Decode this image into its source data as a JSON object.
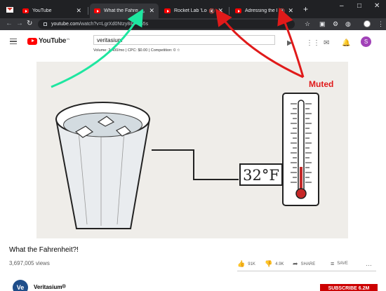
{
  "browser": {
    "tabs": [
      {
        "title": "YouTube",
        "audio": ""
      },
      {
        "title": "What the Fahrenheit",
        "audio": "🔈"
      },
      {
        "title": "Rocket Lab 'Looks",
        "audio": "🔇"
      },
      {
        "title": "Adressing the Ru",
        "audio": "🔇"
      }
    ],
    "new_tab": "+",
    "win_min": "–",
    "win_max": "□",
    "win_close": "✕",
    "url_host": "youtube.com",
    "url_path": "/watch?v=LgrXd0Ntzy8&t=165s"
  },
  "youtube": {
    "logo_word": "YouTube",
    "logo_country": "IN",
    "search_value": "veritasium",
    "seo_line": "Volume: 2,400/mo | CPC: $0.00 | Competition: 0 ☆",
    "avatar_letter": "S"
  },
  "video": {
    "label_temp": "32°F",
    "title": "What the Fahrenheit?!",
    "views": "3,697,005 views",
    "likes": "91K",
    "dislikes": "4.9K",
    "share": "SHARE",
    "save": "SAVE",
    "more": "…"
  },
  "channel": {
    "name": "Veritasium",
    "avatar_text": "Ve",
    "subscribe": "SUBSCRIBE 6.2M"
  },
  "annotation": {
    "muted_label": "Muted",
    "arrow_green": "#1ee6a0",
    "arrow_red": "#e01a1a"
  }
}
